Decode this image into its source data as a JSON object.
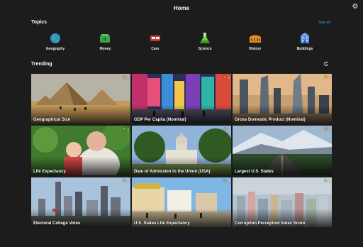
{
  "header": {
    "title": "Home",
    "settings_icon": "gear-icon"
  },
  "topics": {
    "title": "Topics",
    "see_all": "See all",
    "items": [
      {
        "label": "Geography",
        "icon": "globe-icon"
      },
      {
        "label": "Money",
        "icon": "money-icon"
      },
      {
        "label": "Cars",
        "icon": "car-icon"
      },
      {
        "label": "Science",
        "icon": "flask-icon"
      },
      {
        "label": "History",
        "icon": "colosseum-icon"
      },
      {
        "label": "Buildings",
        "icon": "building-icon"
      }
    ]
  },
  "trending": {
    "title": "Trending",
    "refresh_icon": "refresh-icon",
    "cards": [
      {
        "title": "Geographical Size",
        "count": "5",
        "image": "pyramids"
      },
      {
        "title": "GDP Per Capita (Nominal)",
        "count": "0",
        "image": "times-square"
      },
      {
        "title": "Gross Domestic Product (Nominal)",
        "count": "0",
        "image": "skyscrapers"
      },
      {
        "title": "Life Expectancy",
        "count": "0",
        "image": "grandmother-baby"
      },
      {
        "title": "Date of Admission to the Union (USA)",
        "count": "0",
        "image": "capitol"
      },
      {
        "title": "Largest U.S. States",
        "count": "0",
        "image": "mountain-road"
      },
      {
        "title": "Electoral College Votes",
        "count": "0",
        "image": "city-skyline"
      },
      {
        "title": "U.S. States Life Expectancy",
        "count": "0",
        "image": "boardwalk"
      },
      {
        "title": "Corruption Perception Index Score",
        "count": "0",
        "image": "aerial-city"
      }
    ]
  },
  "colors": {
    "background": "#1c1c1c",
    "accent": "#39a6e6",
    "star": "#f2b632"
  }
}
